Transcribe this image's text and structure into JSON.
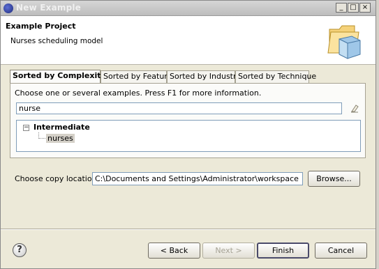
{
  "window": {
    "title": "New Example",
    "minimize": "_",
    "maximize": "□",
    "close": "×"
  },
  "header": {
    "title": "Example Project",
    "description": "Nurses scheduling model"
  },
  "tabs": [
    {
      "label": "Sorted by Complexity",
      "active": true
    },
    {
      "label": "Sorted by Feature",
      "active": false
    },
    {
      "label": "Sorted by Industry",
      "active": false
    },
    {
      "label": "Sorted by Technique",
      "active": false
    }
  ],
  "panel": {
    "hint": "Choose one or several examples. Press F1 for more information.",
    "search_value": "nurse",
    "tree": {
      "category": "Intermediate",
      "expander": "−",
      "item": "nurses"
    }
  },
  "location": {
    "label": "Choose copy location:",
    "value": "C:\\Documents and Settings\\Administrator\\workspace",
    "browse": "Browse..."
  },
  "footer": {
    "back": "< Back",
    "next": "Next >",
    "finish": "Finish",
    "cancel": "Cancel",
    "help": "?"
  }
}
